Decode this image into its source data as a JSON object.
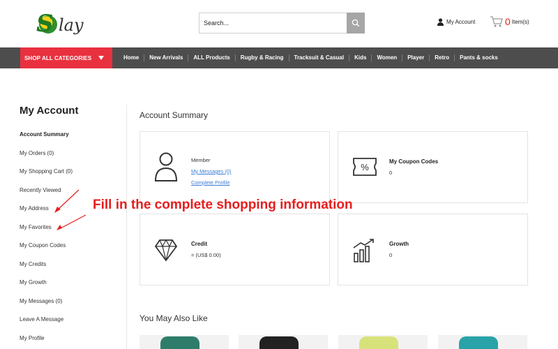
{
  "header": {
    "logo_text": "Splay",
    "search_placeholder": "Search...",
    "account_label": "My Account",
    "cart_count": "0",
    "cart_items_label": "Item(s)"
  },
  "nav": {
    "shop_all": "SHOP ALL CATEGORIES",
    "items": [
      "Home",
      "New Arrivals",
      "ALL Products",
      "Rugby & Racing",
      "Tracksuit & Casual",
      "Kids",
      "Women",
      "Player",
      "Retro",
      "Pants & socks"
    ]
  },
  "sidebar": {
    "title": "My Account",
    "items": [
      "Account Summary",
      "My Orders (0)",
      "My Shopping Cart (0)",
      "Recently Viewed",
      "My Address",
      "My Favorites",
      "My Coupon Codes",
      "My Credits",
      "My Growth",
      "My Messages (0)",
      "Leave A Message",
      "My Profile"
    ]
  },
  "main": {
    "title": "Account Summary",
    "member": {
      "label": "Member",
      "messages_link": "My Messages (0)",
      "profile_link": "Complete Profile"
    },
    "coupons": {
      "label": "My Coupon Codes",
      "value": "0"
    },
    "credit": {
      "label": "Credit",
      "value": "= (US$ 0.00)"
    },
    "growth": {
      "label": "Growth",
      "value": "0"
    },
    "also_like": "You May Also Like"
  },
  "annotation": {
    "text": "Fill in the complete shopping information",
    "color": "#e61e1e"
  },
  "colors": {
    "accent": "#e9303f",
    "navbar": "#4d4d4d",
    "link": "#3a7bd5"
  }
}
